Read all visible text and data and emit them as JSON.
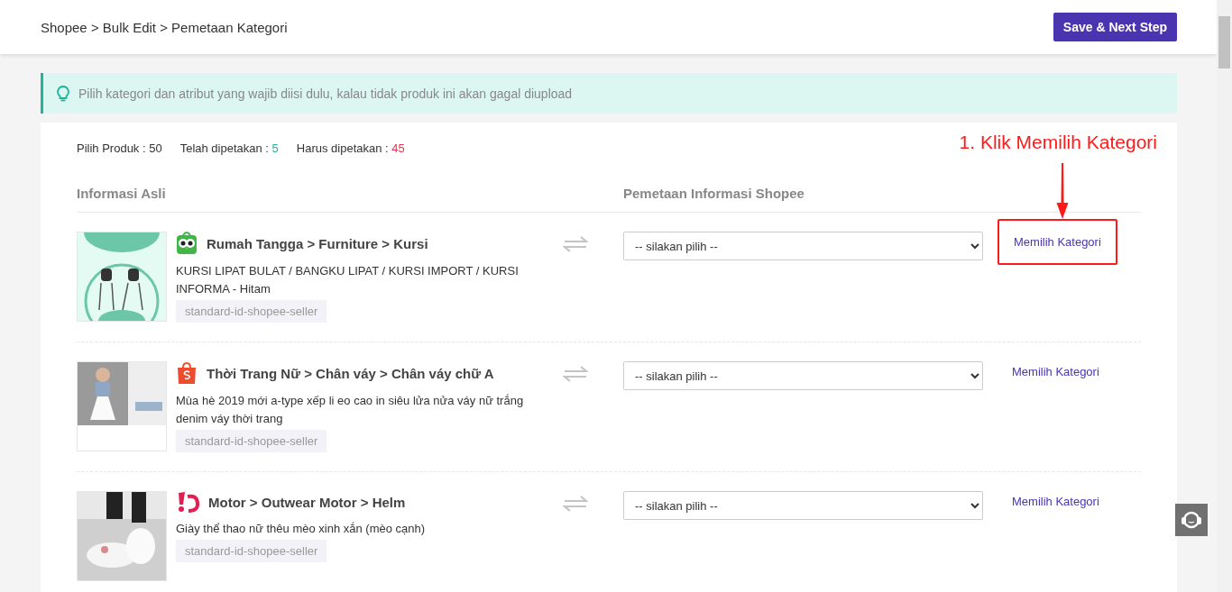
{
  "breadcrumb": "Shopee > Bulk Edit > Pemetaan Kategori",
  "primary_button": "Save & Next Step",
  "notice": "Pilih kategori dan atribut yang wajib diisi dulu, kalau tidak produk ini akan gagal diupload",
  "stats": [
    {
      "label": "Pilih Produk : ",
      "value": "50",
      "kind": "plain"
    },
    {
      "label": "Telah dipetakan : ",
      "value": "5",
      "kind": "good"
    },
    {
      "label": "Harus dipetakan : ",
      "value": "45",
      "kind": "bad"
    }
  ],
  "annotation": "1. Klik Memilih Kategori",
  "columns": [
    "Informasi Asli",
    "Pemetaan Informasi Shopee"
  ],
  "rows": [
    {
      "kind": "tokopedia",
      "category": "Rumah Tangga > Furniture > Kursi",
      "name": "KURSI LIPAT BULAT / BANGKU LIPAT / KURSI IMPORT / KURSI INFORMA - Hitam",
      "tag": "standard-id-shopee-seller",
      "select_placeholder": "-- silakan pilih --",
      "link": "Memilih Kategori",
      "highlighted": true
    },
    {
      "kind": "shopee",
      "category": "Thời Trang Nữ > Chân váy > Chân váy chữ A",
      "name": "Mùa hè 2019 mới a-type xếp li eo cao in siêu lửa nửa váy nữ trắng denim váy thời trang",
      "tag": "standard-id-shopee-seller",
      "select_placeholder": "-- silakan pilih --",
      "link": "Memilih Kategori",
      "highlighted": false
    },
    {
      "kind": "bukalapak",
      "category": "Motor > Outwear Motor > Helm",
      "name": "Giày thể thao nữ thêu mèo xinh xắn (mèo cạnh)",
      "tag": "standard-id-shopee-seller",
      "select_placeholder": "-- silakan pilih --",
      "link": "Memilih Kategori",
      "highlighted": false
    }
  ]
}
